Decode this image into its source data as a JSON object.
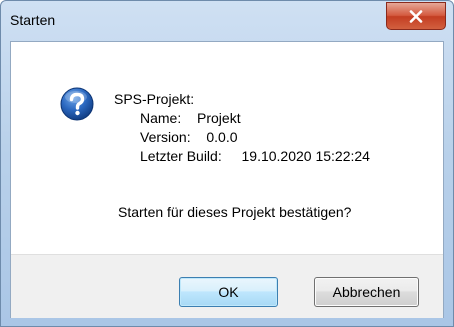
{
  "window": {
    "title": "Starten"
  },
  "project": {
    "header": "SPS-Projekt:",
    "name_label": "Name:",
    "name_value": "Projekt",
    "version_label": "Version:",
    "version_value": "0.0.0",
    "build_label": "Letzter Build:",
    "build_value": "19.10.2020 15:22:24"
  },
  "question": "Starten für dieses Projekt bestätigen?",
  "buttons": {
    "ok_label": "OK",
    "cancel_label": "Abbrechen"
  },
  "icons": {
    "dialog_icon": "help-question-icon",
    "close_icon": "close-x-icon"
  },
  "colors": {
    "help_icon_blue": "#1f5cae",
    "close_button_red": "#c94a30"
  }
}
